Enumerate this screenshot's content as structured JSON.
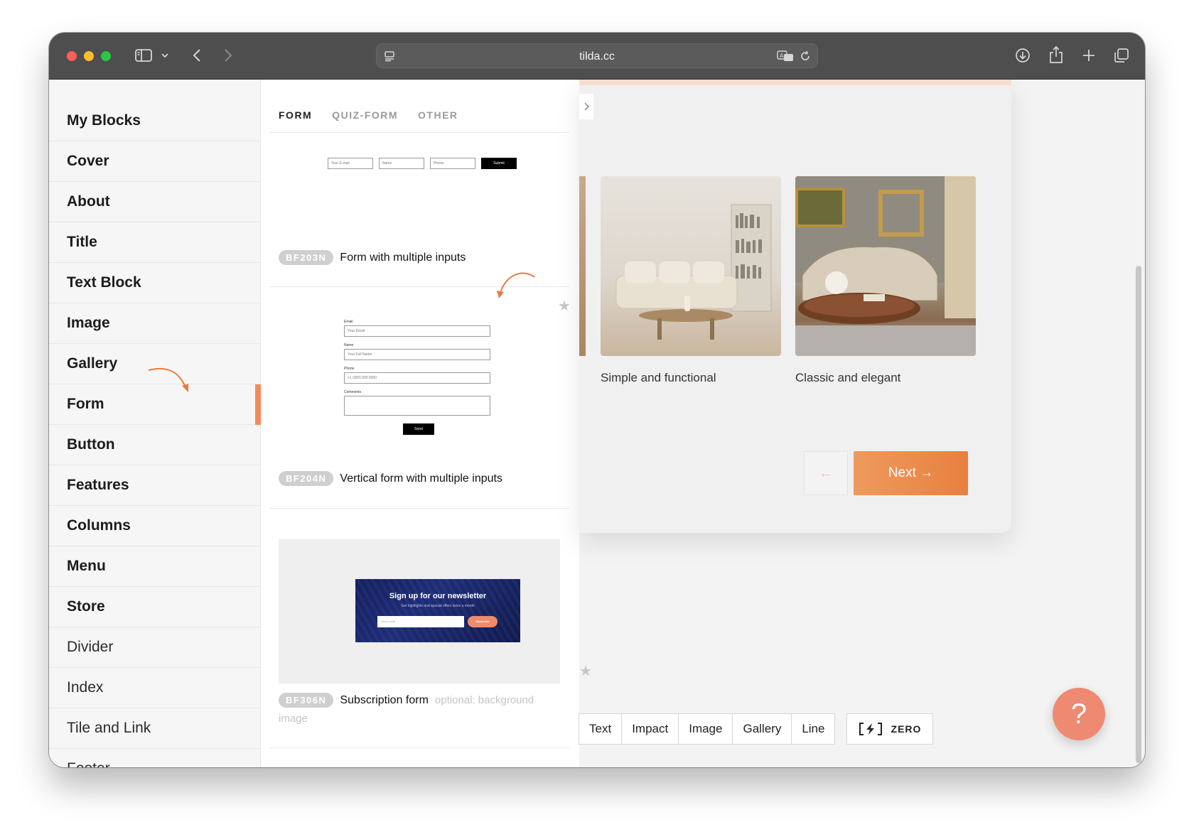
{
  "browser": {
    "url": "tilda.cc"
  },
  "sidebar": {
    "items": [
      {
        "label": "My Blocks",
        "weight": "bold"
      },
      {
        "label": "Cover",
        "weight": "bold"
      },
      {
        "label": "About",
        "weight": "bold"
      },
      {
        "label": "Title",
        "weight": "bold"
      },
      {
        "label": "Text Block",
        "weight": "bold"
      },
      {
        "label": "Image",
        "weight": "bold"
      },
      {
        "label": "Gallery",
        "weight": "bold"
      },
      {
        "label": "Form",
        "weight": "bold",
        "active": true
      },
      {
        "label": "Button",
        "weight": "bold"
      },
      {
        "label": "Features",
        "weight": "bold"
      },
      {
        "label": "Columns",
        "weight": "bold"
      },
      {
        "label": "Menu",
        "weight": "bold"
      },
      {
        "label": "Store",
        "weight": "bold"
      },
      {
        "label": "Divider",
        "weight": "light"
      },
      {
        "label": "Index",
        "weight": "light"
      },
      {
        "label": "Tile and Link",
        "weight": "light"
      },
      {
        "label": "Footer",
        "weight": "light"
      }
    ]
  },
  "panel": {
    "tabs": [
      {
        "label": "FORM",
        "active": true
      },
      {
        "label": "QUIZ-FORM",
        "active": false
      },
      {
        "label": "OTHER",
        "active": false
      }
    ],
    "blocks": [
      {
        "code": "BF203N",
        "title": "Form with multiple inputs",
        "preview": {
          "inputs": [
            "Your E-mail",
            "Name",
            "Phone"
          ],
          "button": "Submit"
        }
      },
      {
        "code": "BF204N",
        "title": "Vertical form with multiple inputs",
        "preview": {
          "fields": [
            {
              "label": "Email",
              "placeholder": "Your Email"
            },
            {
              "label": "Name",
              "placeholder": "Your Full Name"
            },
            {
              "label": "Phone",
              "placeholder": "+1 (000) 000 0000"
            },
            {
              "label": "Comments",
              "placeholder": ""
            }
          ],
          "button": "Send"
        }
      },
      {
        "code": "BF306N",
        "title": "Subscription form",
        "optional_1": "optional: background",
        "optional_2": "image",
        "preview": {
          "heading": "Sign up for our newsletter",
          "subheading": "Get highlights and special offers twice a month",
          "input": "Your e-mail",
          "button": "Subscribe"
        }
      }
    ]
  },
  "preview": {
    "cards": [
      {
        "caption": "Simple and functional"
      },
      {
        "caption": "Classic and elegant"
      }
    ],
    "prev_label": "←",
    "next_label": "Next →"
  },
  "toolbar": {
    "items": [
      "Text",
      "Impact",
      "Image",
      "Gallery",
      "Line"
    ],
    "zero_label": "ZERO"
  },
  "help": {
    "label": "?"
  },
  "colors": {
    "accent": "#f28b5a",
    "next_button": "#e8803f",
    "help_button": "#ef8a72"
  }
}
